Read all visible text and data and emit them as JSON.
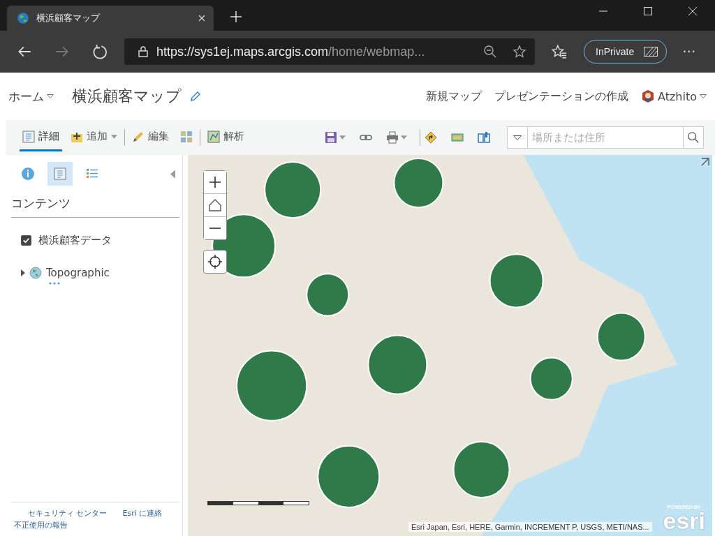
{
  "browser": {
    "tab_title": "横浜顧客マップ",
    "url_host": "https://sys1ej.maps.arcgis.com",
    "url_path": "/home/webmap...",
    "inprivate": "InPrivate",
    "more": "···"
  },
  "header": {
    "home": "ホーム",
    "title": "横浜顧客マップ",
    "nav": [
      "新規マップ",
      "プレゼンテーションの作成"
    ],
    "user": "Atzhito"
  },
  "toolbar": {
    "tools": [
      {
        "kind": "details",
        "label": "詳細",
        "selected": true,
        "dropdown": false
      },
      {
        "kind": "add",
        "label": "追加",
        "selected": false,
        "dropdown": true
      },
      {
        "kind": "edit",
        "label": "編集",
        "selected": false,
        "dropdown": false
      },
      {
        "kind": "basemap",
        "selected": false,
        "dropdown": false
      },
      {
        "kind": "analysis",
        "label": "解析",
        "selected": false,
        "dropdown": false
      }
    ],
    "actions": [
      {
        "kind": "save",
        "dropdown": true
      },
      {
        "kind": "link",
        "dropdown": false
      },
      {
        "kind": "print",
        "dropdown": true
      },
      {
        "kind": "directions",
        "dropdown": false
      },
      {
        "kind": "measure",
        "dropdown": false
      },
      {
        "kind": "bookmarks",
        "dropdown": false
      }
    ],
    "search": {
      "placeholder": "場所または住所"
    }
  },
  "sidebar": {
    "tabs": [
      {
        "kind": "info",
        "selected": false
      },
      {
        "kind": "details",
        "selected": true
      },
      {
        "kind": "legend",
        "selected": false
      }
    ],
    "heading": "コンテンツ",
    "layers": [
      {
        "kind": "layer",
        "name": "横浜顧客データ",
        "checked": true
      },
      {
        "kind": "basemap",
        "name": "Topographic",
        "expanded": false
      }
    ],
    "footer_links": [
      "セキュリティ センター",
      "Esri に連絡",
      "不正使用の報告"
    ]
  },
  "map": {
    "attribution": "Esri Japan, Esri, HERE, Garmin, INCREMENT P, USGS, METI/NAS...",
    "logo_caption": "POWERED BY",
    "logo": "esri"
  }
}
